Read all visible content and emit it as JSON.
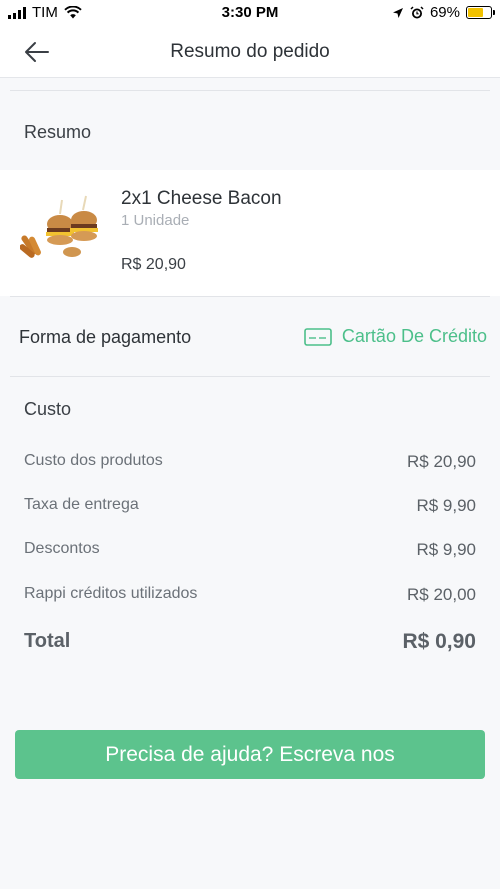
{
  "status_bar": {
    "carrier": "TIM",
    "time": "3:30 PM",
    "battery": "69%",
    "battery_level": 0.69
  },
  "header": {
    "title": "Resumo do pedido",
    "back_icon": "back-arrow-icon"
  },
  "summary": {
    "section_title": "Resumo"
  },
  "product": {
    "name": "2x1 Cheese Bacon",
    "quantity": "1 Unidade",
    "price": "R$ 20,90",
    "image_icon": "burger-image"
  },
  "payment": {
    "label": "Forma de pagamento",
    "method": "Cartão De Crédito",
    "icon": "credit-card-icon"
  },
  "cost": {
    "section_title": "Custo",
    "rows": [
      {
        "label": "Custo dos produtos",
        "value": "R$ 20,90"
      },
      {
        "label": "Taxa de entrega",
        "value": "R$ 9,90"
      },
      {
        "label": "Descontos",
        "value": "R$ 9,90"
      },
      {
        "label": "Rappi créditos utilizados",
        "value": "R$ 20,00"
      }
    ],
    "total_label": "Total",
    "total_value": "R$ 0,90"
  },
  "help_button": {
    "label": "Precisa de ajuda? Escreva nos"
  },
  "colors": {
    "accent": "#5cc38d",
    "payment_text": "#4cbf8a",
    "background": "#f7f8fa"
  }
}
